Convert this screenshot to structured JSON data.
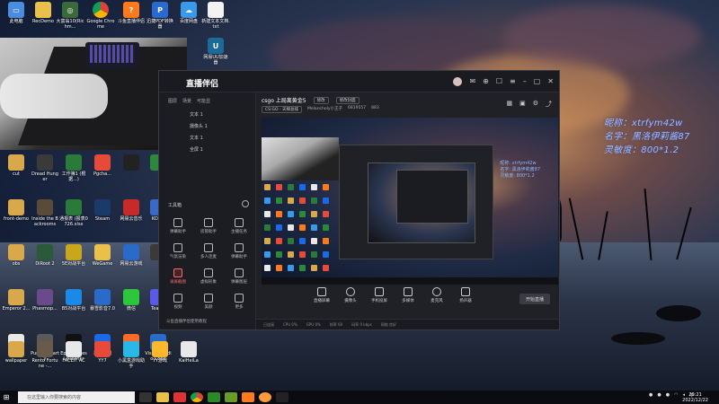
{
  "desktop": {
    "top_icons": [
      {
        "label": "此电脑"
      },
      {
        "label": "RecDemo"
      },
      {
        "label": "大富翁10(Richm..."
      },
      {
        "label": "Google Chrome"
      },
      {
        "label": "斗鱼直播伴侣"
      },
      {
        "label": "迅捷PDF转换器"
      },
      {
        "label": "百度网盘"
      },
      {
        "label": "新建文本文档.txt"
      }
    ],
    "col_icons": [
      {
        "label": "cut"
      },
      {
        "label": "Dread Hunger"
      },
      {
        "label": "工作簿1 (根据...)"
      },
      {
        "label": "Pgcha..."
      },
      {
        "label": ""
      },
      {
        "label": ""
      },
      {
        "label": "front-demo"
      },
      {
        "label": "Inside the Backrooms"
      },
      {
        "label": "通报表 (报表0726.xlsx"
      },
      {
        "label": "Steam"
      },
      {
        "label": "网易云音乐"
      },
      {
        "label": "KOOK"
      },
      {
        "label": "obs"
      },
      {
        "label": "DiRoot 2"
      },
      {
        "label": "5E对战平台"
      },
      {
        "label": "WeGame"
      },
      {
        "label": "网易云游戏"
      },
      {
        "label": ""
      },
      {
        "label": "Emperor 2..."
      },
      {
        "label": "Phasmop..."
      },
      {
        "label": "B5对战平台"
      },
      {
        "label": "暴雪影音7.0"
      },
      {
        "label": "微信"
      },
      {
        "label": "Teams"
      },
      {
        "label": "test"
      },
      {
        "label": "Pummel Party"
      },
      {
        "label": "Epic Games Launcher"
      },
      {
        "label": "暴雪战网"
      },
      {
        "label": "向日葵"
      },
      {
        "label": "Visual Studio Code"
      },
      {
        "label": "wallpaper"
      },
      {
        "label": "Rento Fortune -..."
      },
      {
        "label": "FACEIT AC"
      },
      {
        "label": "YY7"
      },
      {
        "label": "小黑盒游戏助手"
      },
      {
        "label": "YY游戏"
      },
      {
        "label": "KaiHeiLa"
      }
    ],
    "extra_icon": {
      "label": "网易UU加速器"
    }
  },
  "app": {
    "brand": "直播伴侣",
    "sidebar_tabs": [
      "图层",
      "场景",
      "可能显"
    ],
    "layers": [
      "文本 1",
      "摄像头 1",
      "文本 1",
      "全屏 1"
    ],
    "tools_title": "工具箱",
    "tools": [
      {
        "label": "弹幕助手"
      },
      {
        "label": "房管助手"
      },
      {
        "label": "主播任务"
      },
      {
        "label": "气氛渲染"
      },
      {
        "label": "多人连麦"
      },
      {
        "label": "弹幕助手"
      },
      {
        "label": "录屏截图",
        "active": true
      },
      {
        "label": "虚拟形象"
      },
      {
        "label": "弹幕图层"
      },
      {
        "label": "视频"
      },
      {
        "label": "美颜"
      },
      {
        "label": "更多"
      }
    ],
    "sidebar_footer": "斗鱼直播伴侣使用教程",
    "room_title": "csgo 上局离黄金5",
    "chip_edit": "修改",
    "chip_cover": "修改封面",
    "game": "CS:GO - 天梯总排",
    "streamer": "Melancholy小王子",
    "room_id": "6819557",
    "viewers": "883",
    "preview_overlay": [
      "昵称: xtrfym42w",
      "名字: 黑洛伊莉酱87",
      "灵敏度: 800*1.2"
    ],
    "bottom_buttons": [
      "直播屏幕",
      "摄像头",
      "手机投屏",
      "多媒体",
      "麦克风",
      "扬声器"
    ],
    "start_button": "开始直播",
    "status": [
      "已连接",
      "CPU 0%",
      "GPU 0%",
      "帧率 60",
      "码率 0 kbps",
      "网络 良好"
    ]
  },
  "overlay": {
    "line1": "昵称：xtrfym42w",
    "line2": "名字：黑洛伊莉酱87",
    "line3": "灵敏度：800*1.2"
  },
  "taskbar": {
    "search_placeholder": "在这里输入你要搜索的内容",
    "clock_time": "20:21",
    "clock_date": "2022/12/22"
  }
}
